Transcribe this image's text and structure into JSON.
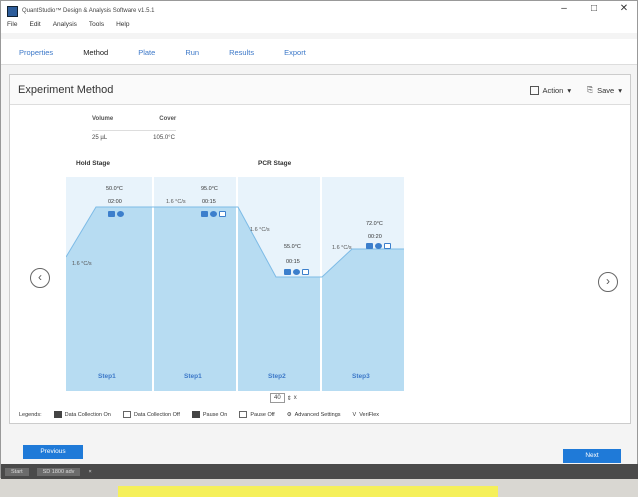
{
  "window": {
    "title": "QuantStudio™ Design & Analysis Software v1.5.1",
    "controls": [
      "–",
      "□",
      "✕"
    ]
  },
  "menu": [
    "File",
    "Edit",
    "Analysis",
    "Tools",
    "Help"
  ],
  "tabs": [
    "Properties",
    "Method",
    "Plate",
    "Run",
    "Results",
    "Export"
  ],
  "panel": {
    "title": "Experiment Method",
    "action_label": "Action",
    "save_label": "Save"
  },
  "vc": {
    "volume_head": "Volume",
    "cover_head": "Cover",
    "volume_value": "25",
    "volume_unit": "µL",
    "cover_value": "105.0°C"
  },
  "stages": {
    "hold": "Hold Stage",
    "pcr": "PCR Stage"
  },
  "steps": [
    {
      "temp": "50.0°C",
      "time": "02:00",
      "ramp": "1.6 °C/s",
      "label": "Step1"
    },
    {
      "temp": "95.0°C",
      "time": "00:15",
      "ramp": "1.6 °C/s",
      "label": "Step1"
    },
    {
      "temp": "55.0°C",
      "time": "00:15",
      "ramp": "1.6 °C/s",
      "label": "Step2"
    },
    {
      "temp": "72.0°C",
      "time": "00:20",
      "ramp": "1.6 °C/s",
      "label": "Step3"
    }
  ],
  "first_ramp": "1.6 °C/s",
  "cycles": "40",
  "cycles_unit": "x",
  "legend": {
    "title": "Legends:",
    "items": [
      "Data Collection On",
      "Data Collection Off",
      "Pause On",
      "Pause Off",
      "Advanced Settings",
      "VeriFlex"
    ]
  },
  "buttons": {
    "previous": "Previous",
    "next": "Next"
  },
  "taskbar": {
    "start": "Start",
    "item": "SD 1800 adv"
  }
}
